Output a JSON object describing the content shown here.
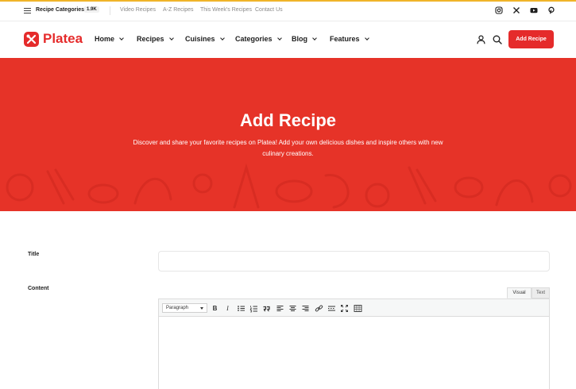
{
  "topbar": {
    "categories_label": "Recipe Categories",
    "categories_count": "1.9K",
    "links": [
      "Video Recipes",
      "A-Z Recipes",
      "This Week's Recipes",
      "Contact Us"
    ],
    "social_icons": [
      "instagram-icon",
      "x-icon",
      "youtube-icon",
      "pinterest-icon"
    ]
  },
  "header": {
    "logo": "Platea",
    "nav": [
      "Home",
      "Recipes",
      "Cuisines",
      "Categories",
      "Blog",
      "Features"
    ],
    "cta_label": "Add Recipe"
  },
  "hero": {
    "title": "Add Recipe",
    "subtitle": "Discover and share your favorite recipes on Platea! Add your own delicious dishes and inspire others with new culinary creations."
  },
  "form": {
    "title_label": "Title",
    "title_value": "",
    "content_label": "Content",
    "tabs": [
      "Visual",
      "Text"
    ],
    "format_value": "Paragraph",
    "toolbar_buttons": [
      "B",
      "I"
    ]
  },
  "colors": {
    "brand": "#e52b2b",
    "hero_bg": "#e63328",
    "top_accent": "#f0b429"
  }
}
